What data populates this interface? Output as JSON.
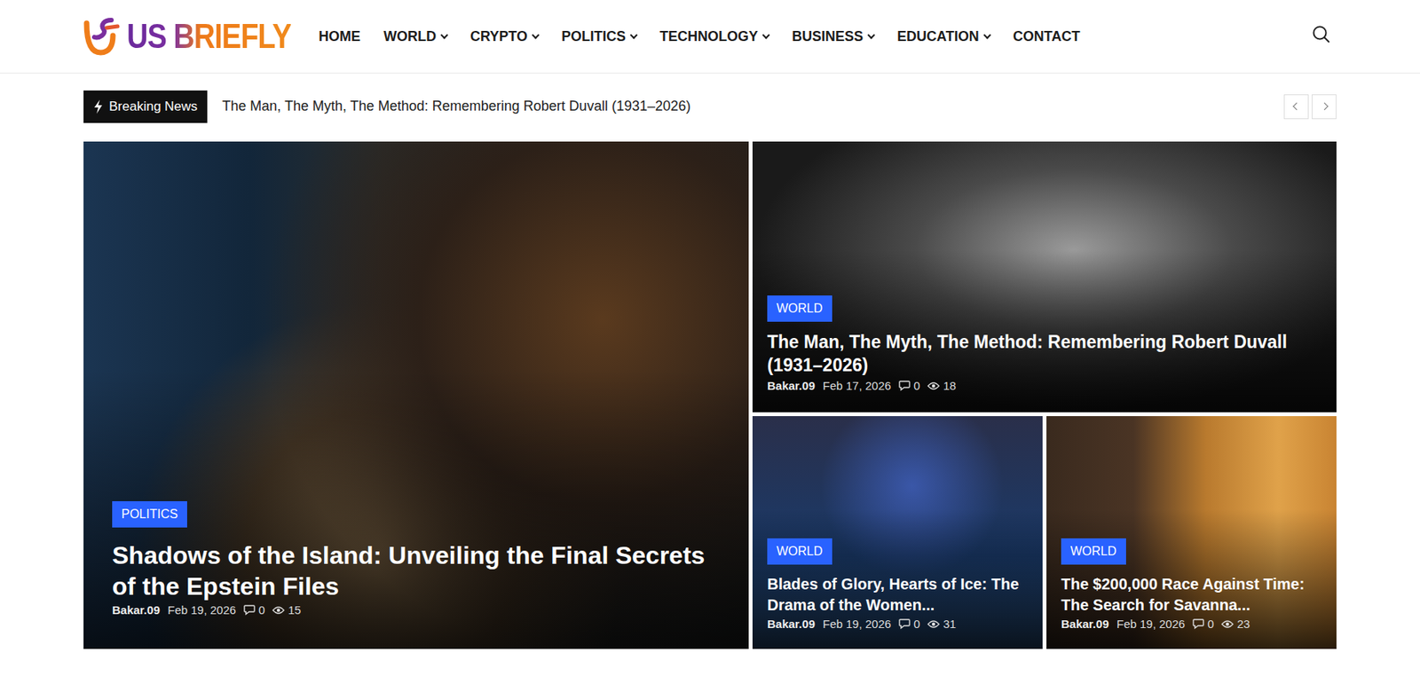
{
  "header": {
    "logo": "US BRIEFLY",
    "nav": [
      {
        "label": "HOME",
        "dropdown": false
      },
      {
        "label": "WORLD",
        "dropdown": true
      },
      {
        "label": "CRYPTO",
        "dropdown": true
      },
      {
        "label": "POLITICS",
        "dropdown": true
      },
      {
        "label": "TECHNOLOGY",
        "dropdown": true
      },
      {
        "label": "BUSINESS",
        "dropdown": true
      },
      {
        "label": "EDUCATION",
        "dropdown": true
      },
      {
        "label": "CONTACT",
        "dropdown": false
      }
    ]
  },
  "breaking": {
    "label": "Breaking News",
    "headline": "The Man, The Myth, The Method: Remembering Robert Duvall (1931–2026)"
  },
  "posts": [
    {
      "category": "POLITICS",
      "title": "Shadows of the Island: Unveiling the Final Secrets of the Epstein Files",
      "author": "Bakar.09",
      "date": "Feb 19, 2026",
      "comments": "0",
      "views": "15"
    },
    {
      "category": "WORLD",
      "title": "The Man, The Myth, The Method: Remembering Robert Duvall (1931–2026)",
      "author": "Bakar.09",
      "date": "Feb 17, 2026",
      "comments": "0",
      "views": "18"
    },
    {
      "category": "WORLD",
      "title": "Blades of Glory, Hearts of Ice: The Drama of the Women...",
      "author": "Bakar.09",
      "date": "Feb 19, 2026",
      "comments": "0",
      "views": "31"
    },
    {
      "category": "WORLD",
      "title": "The $200,000 Race Against Time: The Search for Savanna...",
      "author": "Bakar.09",
      "date": "Feb 19, 2026",
      "comments": "0",
      "views": "23"
    }
  ]
}
